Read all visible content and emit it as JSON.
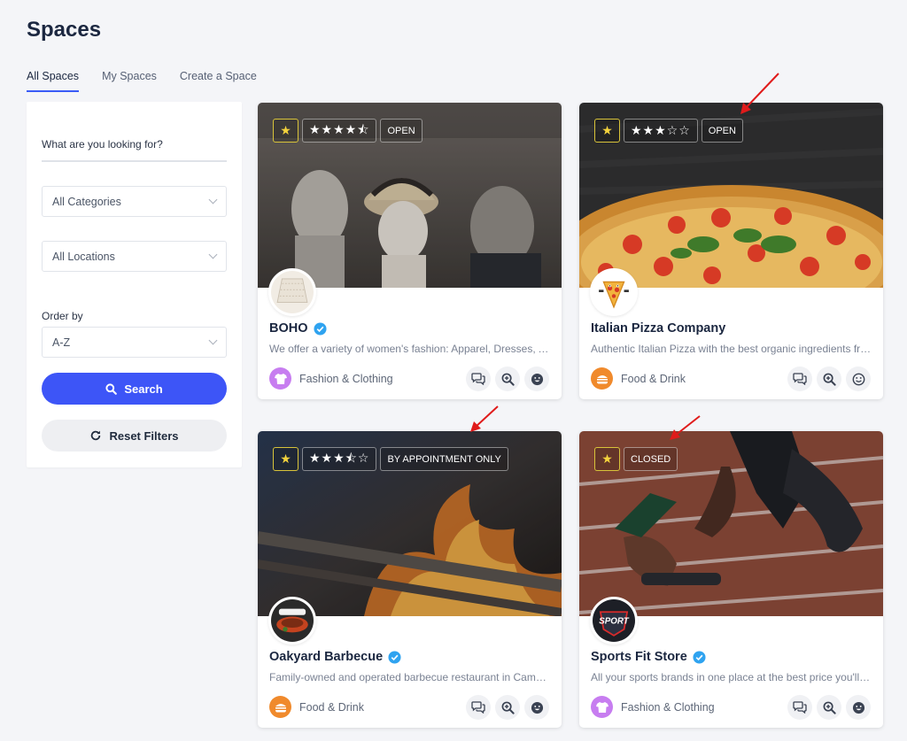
{
  "page": {
    "title": "Spaces"
  },
  "tabs": [
    {
      "label": "All Spaces",
      "active": true
    },
    {
      "label": "My Spaces",
      "active": false
    },
    {
      "label": "Create a Space",
      "active": false
    }
  ],
  "filters": {
    "search_placeholder": "What are you looking for?",
    "category_value": "All Categories",
    "location_value": "All Locations",
    "order_label": "Order by",
    "order_value": "A-Z",
    "search_button": "Search",
    "reset_button": "Reset Filters"
  },
  "cards": [
    {
      "title": "BOHO",
      "verified": true,
      "description": "We offer a variety of women's fashion: Apparel, Dresses, Accessories and more",
      "rating_stars": "★★★★⯪",
      "rating": 4.5,
      "status": "OPEN",
      "category": "Fashion & Clothing",
      "category_color": "#c77df0",
      "category_icon": "tshirt-icon"
    },
    {
      "title": "Italian Pizza Company",
      "verified": false,
      "description": "Authentic Italian Pizza with the best organic ingredients from Italy",
      "rating_stars": "★★★☆☆",
      "rating": 3,
      "status": "OPEN",
      "category": "Food & Drink",
      "category_color": "#f08a2c",
      "category_icon": "burger-icon"
    },
    {
      "title": "Oakyard Barbecue",
      "verified": true,
      "description": "Family-owned and operated barbecue restaurant in Camden",
      "rating_stars": "★★★⯪☆",
      "rating": 3.5,
      "status": "BY APPOINTMENT ONLY",
      "category": "Food & Drink",
      "category_color": "#f08a2c",
      "category_icon": "burger-icon"
    },
    {
      "title": "Sports Fit Store",
      "verified": true,
      "description": "All your sports brands in one place at the best price you'll find",
      "rating_stars": "",
      "rating": null,
      "status": "CLOSED",
      "category": "Fashion & Clothing",
      "category_color": "#c77df0",
      "category_icon": "tshirt-icon"
    }
  ],
  "colors": {
    "accent": "#3d55f7",
    "feature_star": "#f4d33d",
    "verified": "#2fa3f0",
    "annotation_arrow": "#e01b1b"
  }
}
